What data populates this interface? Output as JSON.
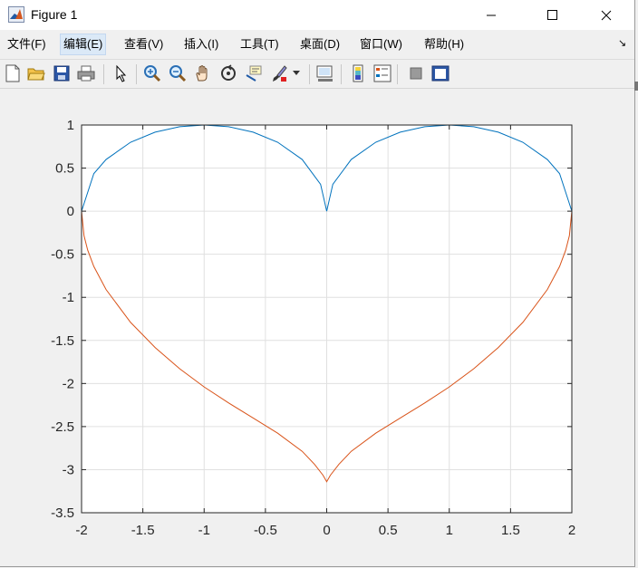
{
  "window": {
    "title": "Figure 1",
    "icon": "matlab-icon",
    "controls": [
      "minimize-icon",
      "maximize-icon",
      "close-icon"
    ]
  },
  "menu": {
    "items": [
      {
        "label": "文件(F)",
        "active": false
      },
      {
        "label": "编辑(E)",
        "active": true
      },
      {
        "label": "查看(V)",
        "active": false
      },
      {
        "label": "插入(I)",
        "active": false
      },
      {
        "label": "工具(T)",
        "active": false
      },
      {
        "label": "桌面(D)",
        "active": false
      },
      {
        "label": "窗口(W)",
        "active": false
      },
      {
        "label": "帮助(H)",
        "active": false
      }
    ],
    "dock_arrow": "↘"
  },
  "toolbar": {
    "icons": [
      "new-figure-icon",
      "open-file-icon",
      "save-icon",
      "print-icon",
      "edit-plot-arrow-icon",
      "zoom-in-icon",
      "zoom-out-icon",
      "pan-hand-icon",
      "rotate-3d-icon",
      "data-cursor-icon",
      "brush-icon",
      "brush-dropdown-icon",
      "link-plot-icon",
      "insert-colorbar-icon",
      "insert-legend-icon",
      "hide-plot-tools-icon",
      "show-plot-tools-icon"
    ]
  },
  "chart_data": {
    "type": "line",
    "title": "",
    "xlabel": "",
    "ylabel": "",
    "xlim": [
      -2,
      2
    ],
    "ylim": [
      -3.5,
      1
    ],
    "grid": true,
    "xticks": [
      "-2",
      "-1.5",
      "-1",
      "-0.5",
      "0",
      "0.5",
      "1",
      "1.5",
      "2"
    ],
    "yticks": [
      "1",
      "0.5",
      "0",
      "-0.5",
      "-1",
      "-1.5",
      "-2",
      "-2.5",
      "-3",
      "-3.5"
    ],
    "colors": {
      "upper": "#0072bd",
      "lower": "#d95319",
      "grid": "#e0e0e0",
      "axis": "#262626"
    },
    "series": [
      {
        "x": [
          -2,
          -1.9,
          -1.8,
          -1.6,
          -1.4,
          -1.2,
          -1,
          -0.8,
          -0.6,
          -0.4,
          -0.2,
          -0.05,
          0,
          0.05,
          0.2,
          0.4,
          0.6,
          0.8,
          1,
          1.2,
          1.4,
          1.6,
          1.8,
          1.9,
          2
        ],
        "y": [
          0,
          0.436,
          0.6,
          0.8,
          0.917,
          0.98,
          1,
          0.98,
          0.917,
          0.8,
          0.6,
          0.312,
          0,
          0.312,
          0.6,
          0.8,
          0.917,
          0.98,
          1,
          0.98,
          0.917,
          0.8,
          0.6,
          0.436,
          0
        ]
      },
      {
        "x": [
          -2,
          -1.98,
          -1.95,
          -1.9,
          -1.8,
          -1.6,
          -1.4,
          -1.2,
          -1,
          -0.8,
          -0.6,
          -0.4,
          -0.2,
          -0.1,
          -0.03,
          0,
          0.03,
          0.1,
          0.2,
          0.4,
          0.6,
          0.8,
          1,
          1.2,
          1.4,
          1.6,
          1.8,
          1.9,
          1.95,
          1.98,
          2
        ],
        "y": [
          0,
          -0.284,
          -0.452,
          -0.642,
          -0.91,
          -1.291,
          -1.582,
          -1.828,
          -2.04,
          -2.226,
          -2.401,
          -2.577,
          -2.787,
          -2.937,
          -3.065,
          -3.14,
          -3.065,
          -2.937,
          -2.787,
          -2.577,
          -2.401,
          -2.226,
          -2.04,
          -1.828,
          -1.582,
          -1.291,
          -0.91,
          -0.642,
          -0.452,
          -0.284,
          0
        ]
      }
    ]
  }
}
